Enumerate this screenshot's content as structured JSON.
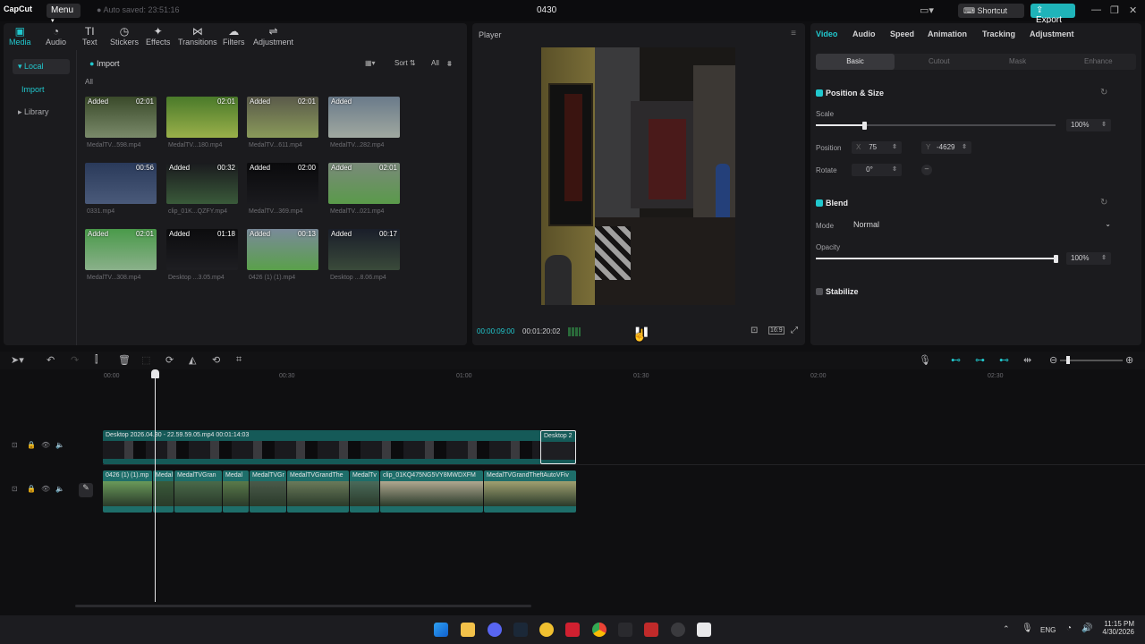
{
  "titlebar": {
    "logo": "CapCut",
    "menu_label": "Menu",
    "autosave": "Auto saved: 23:51:16",
    "project_title": "0430",
    "shortcut_label": "Shortcut",
    "export_label": "Export"
  },
  "toolbar_tabs": [
    "Media",
    "Audio",
    "Text",
    "Stickers",
    "Effects",
    "Transitions",
    "Filters",
    "Adjustment"
  ],
  "toolbar_icons": [
    "media-icon",
    "audio-icon",
    "text-icon",
    "stickers-icon",
    "effects-icon",
    "transitions-icon",
    "filters-icon",
    "adjustment-icon"
  ],
  "media_sidebar": {
    "local": "Local",
    "import": "Import",
    "library": "Library"
  },
  "media_header": {
    "import": "Import",
    "sort": "Sort",
    "all": "All",
    "section": "All"
  },
  "media_items": [
    {
      "added": "Added",
      "duration": "02:01",
      "name": "MedalTV...598.mp4",
      "colors": [
        "#3a4a2a",
        "#7a8a6a"
      ]
    },
    {
      "added": "",
      "duration": "02:01",
      "name": "MedalTV...180.mp4",
      "colors": [
        "#4a7a2a",
        "#9ab04a"
      ]
    },
    {
      "added": "Added",
      "duration": "02:01",
      "name": "MedalTV...611.mp4",
      "colors": [
        "#5a5a4a",
        "#8a9a5a"
      ]
    },
    {
      "added": "Added",
      "duration": "",
      "name": "MedalTV...282.mp4",
      "colors": [
        "#6a7a8a",
        "#a0a8a0"
      ]
    },
    {
      "added": "",
      "duration": "00:56",
      "name": "0331.mp4",
      "colors": [
        "#2a3a5a",
        "#4a5a7a"
      ]
    },
    {
      "added": "Added",
      "duration": "00:32",
      "name": "clip_01K...QZFY.mp4",
      "colors": [
        "#1a1a1e",
        "#3a5a3a"
      ]
    },
    {
      "added": "Added",
      "duration": "02:00",
      "name": "MedalTV...369.mp4",
      "colors": [
        "#0a0a0c",
        "#1a1a1e"
      ]
    },
    {
      "added": "Added",
      "duration": "02:01",
      "name": "MedalTV...021.mp4",
      "colors": [
        "#7a8a7a",
        "#5a9a4a"
      ]
    },
    {
      "added": "Added",
      "duration": "02:01",
      "name": "MedalTV...308.mp4",
      "colors": [
        "#4a9a4a",
        "#8ab08a"
      ]
    },
    {
      "added": "Added",
      "duration": "01:18",
      "name": "Desktop ...3.05.mp4",
      "colors": [
        "#0c0c0e",
        "#1e1e22"
      ]
    },
    {
      "added": "Added",
      "duration": "00:13",
      "name": "0426 (1) (1).mp4",
      "colors": [
        "#7a8a9a",
        "#5aa04a"
      ]
    },
    {
      "added": "Added",
      "duration": "00:17",
      "name": "Desktop ...8.06.mp4",
      "colors": [
        "#1a1e2a",
        "#3a4a3a"
      ]
    }
  ],
  "player": {
    "title": "Player",
    "current_time": "00:00:09:00",
    "total_time": "00:01:20:02",
    "aspect_label": "16:9"
  },
  "props_tabs": [
    "Video",
    "Audio",
    "Speed",
    "Animation",
    "Tracking",
    "Adjustment"
  ],
  "props_subtabs": [
    "Basic",
    "Cutout",
    "Mask",
    "Enhance"
  ],
  "position_size": {
    "title": "Position & Size",
    "scale_label": "Scale",
    "scale_value": "100%",
    "scale_fraction": 0.2,
    "position_label": "Position",
    "x_label": "X",
    "x_value": "75",
    "y_label": "Y",
    "y_value": "-4629",
    "rotate_label": "Rotate",
    "rotate_value": "0°"
  },
  "blend": {
    "title": "Blend",
    "mode_label": "Mode",
    "mode_value": "Normal",
    "opacity_label": "Opacity",
    "opacity_value": "100%",
    "opacity_fraction": 1.0
  },
  "stabilize": {
    "title": "Stabilize"
  },
  "timeline": {
    "ruler": [
      "00:00",
      "00:30",
      "01:00",
      "01:30",
      "02:00",
      "02:30"
    ],
    "clip_top_label": "Desktop 2026.04.30 - 22.59.59.05.mp4  00:01:14:03",
    "clip_top_tail": "Desktop 2",
    "clip_bottom_labels": [
      "0426 (1) (1).mp",
      "Medal",
      "MedalTVGran",
      "Medal",
      "MedalTVGr",
      "MedalTVGrandThe",
      "MedalTv",
      "clip_01KQ475NG5VY8MWDXFM",
      "MedalTVGrandTheftAutoVFiv"
    ]
  },
  "taskbar": {
    "lang": "ENG",
    "time": "11:15 PM",
    "date": "4/30/2026"
  }
}
